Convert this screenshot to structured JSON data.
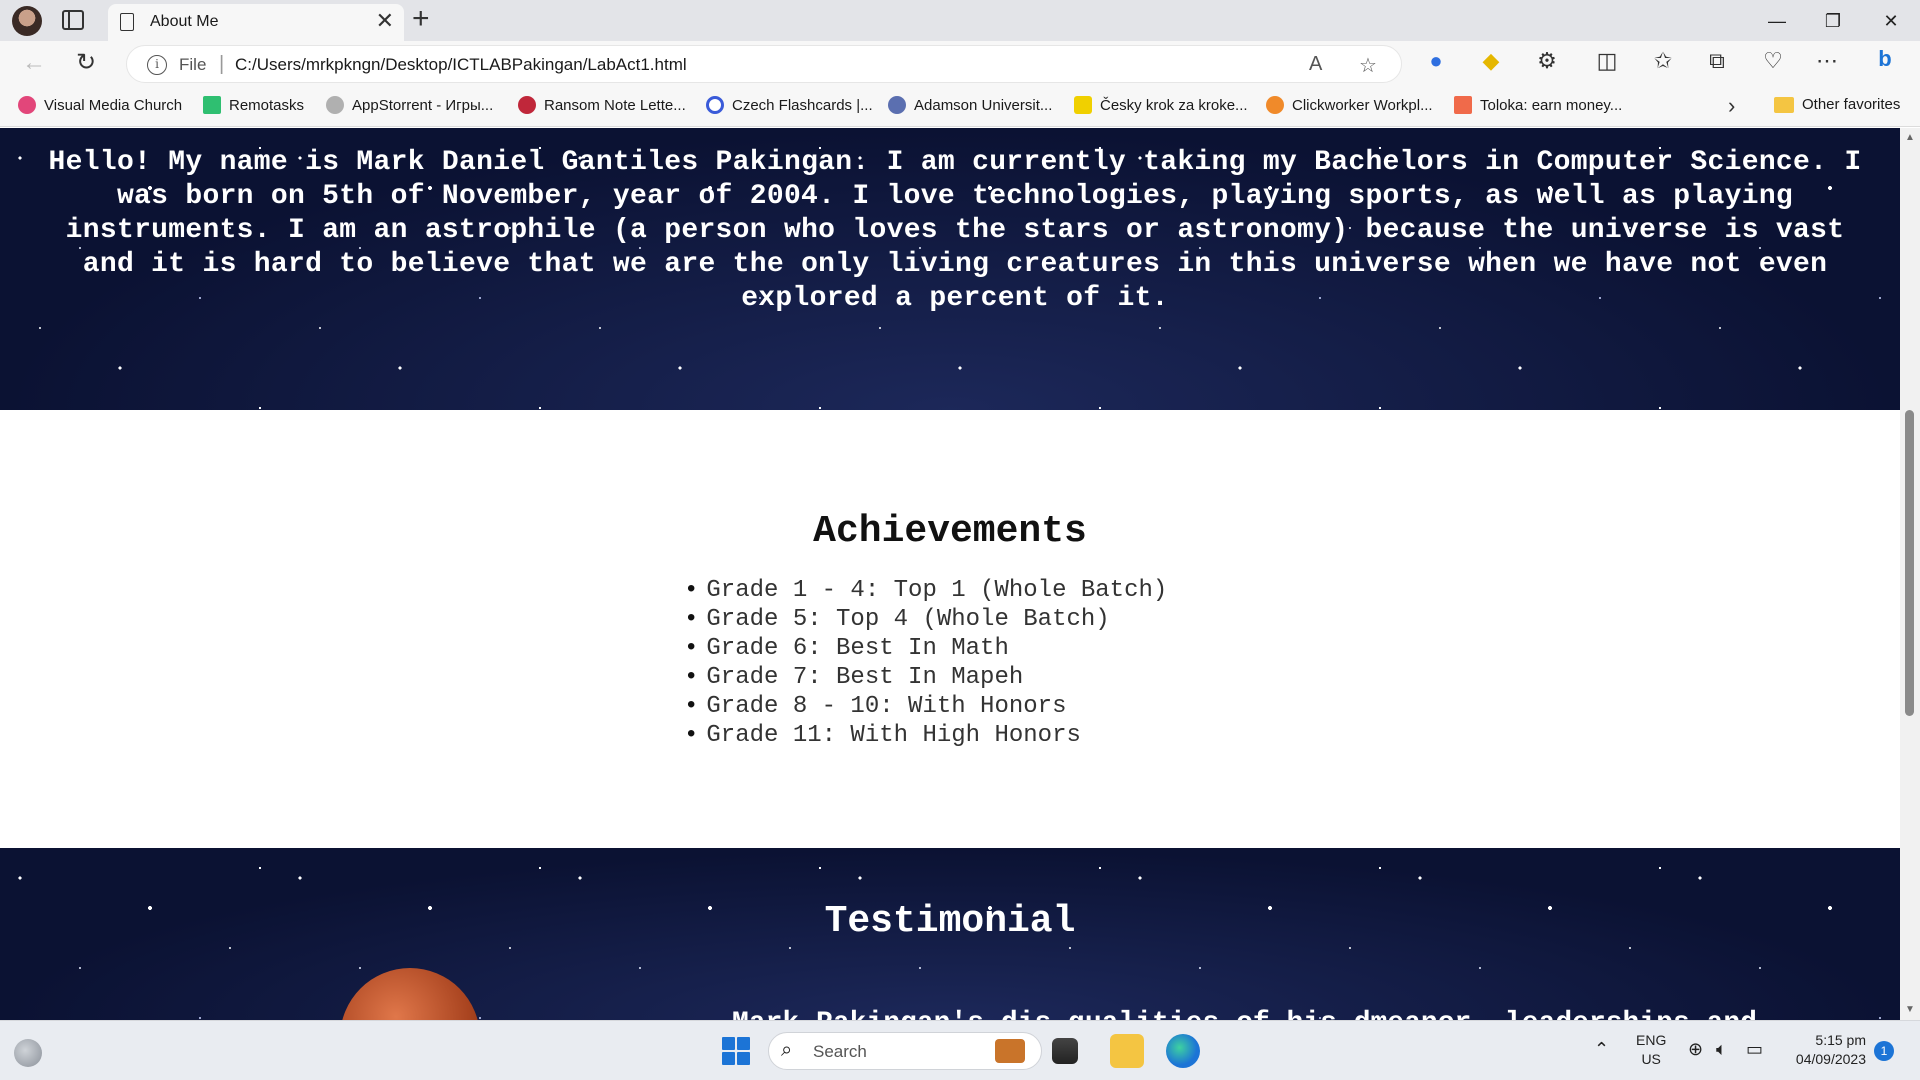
{
  "browser": {
    "tab_title": "About Me",
    "new_tab_symbol": "+",
    "close_symbol": "✕",
    "window_controls": [
      "—",
      "❐",
      "✕"
    ],
    "address": {
      "scheme_label": "File",
      "url": "C:/Users/mrkpkngn/Desktop/ICTLABPakingan/LabAct1.html"
    },
    "favorites": [
      {
        "label": "Visual Media Church",
        "icon_color": "#e2467a"
      },
      {
        "label": "Remotasks",
        "icon_color": "#2fbf71"
      },
      {
        "label": "AppStorrent - Игры...",
        "icon_color": "#b0b0b0"
      },
      {
        "label": "Ransom Note Lette...",
        "icon_color": "#c0273a"
      },
      {
        "label": "Czech Flashcards |...",
        "icon_color": "#3a5bd9"
      },
      {
        "label": "Adamson Universit...",
        "icon_color": "#5b6fb0"
      },
      {
        "label": "Česky krok za kroke...",
        "icon_color": "#f0d000"
      },
      {
        "label": "Clickworker Workpl...",
        "icon_color": "#f08a2a"
      },
      {
        "label": "Toloka: earn money...",
        "icon_color": "#f06a4a"
      }
    ],
    "other_favorites_label": "Other favorites"
  },
  "page": {
    "about_text": "Hello! My name is Mark Daniel Gantiles Pakingan. I am currently taking my Bachelors in Computer Science. I was born on 5th of November, year of 2004. I love technologies, playing sports, as well as playing instruments. I am an astrophile (a person who loves the stars or astronomy) because the universe is vast and it is hard to believe that we are the only living creatures in this universe when we have not even explored a percent of it.",
    "achievements": {
      "title": "Achievements",
      "items": [
        "Grade 1 - 4: Top 1 (Whole Batch)",
        "Grade 5: Top 4 (Whole Batch)",
        "Grade 6: Best In Math",
        "Grade 7: Best In Mapeh",
        "Grade 8 - 10: With Honors",
        "Grade 11: With High Honors"
      ]
    },
    "testimonial": {
      "title": "Testimonial",
      "peek_text": "Mark Pakingan's dis qualities of his dmeanor, leaderships and"
    }
  },
  "taskbar": {
    "search_label": "Search",
    "language": [
      "ENG",
      "US"
    ],
    "time": "5:15 pm",
    "date": "04/09/2023",
    "notification_count": "1"
  }
}
